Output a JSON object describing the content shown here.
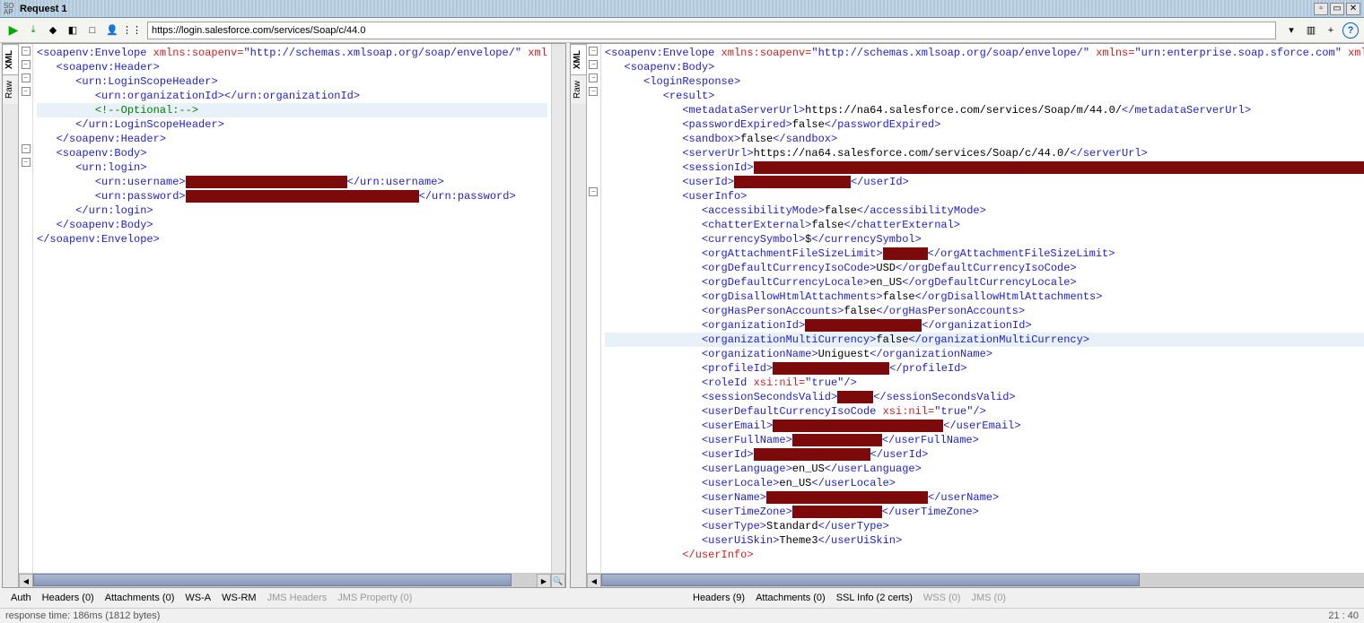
{
  "title": "Request 1",
  "soap_icon": "SO\nAP",
  "url": "https://login.salesforce.com/services/Soap/c/44.0",
  "side_tabs": [
    "XML",
    "Raw"
  ],
  "request_xml": {
    "lines": [
      {
        "p": "<soapenv:Envelope ",
        "a": "xmlns:soapenv=",
        "s": "\"http://schemas.xmlsoap.org/soap/envelope/\"",
        "t": " xml"
      },
      {
        "i": 1,
        "p": "<soapenv:Header>"
      },
      {
        "i": 2,
        "p": "<urn:LoginScopeHeader>"
      },
      {
        "i": 3,
        "p": "<urn:organizationId></urn:organizationId>"
      },
      {
        "i": 3,
        "c": "<!--Optional:-->",
        "hl": true
      },
      {
        "i": 2,
        "p": "</urn:LoginScopeHeader>"
      },
      {
        "i": 1,
        "p": "</soapenv:Header>"
      },
      {
        "i": 1,
        "p": "<soapenv:Body>"
      },
      {
        "i": 2,
        "p": "<urn:login>"
      },
      {
        "i": 3,
        "p": "<urn:username>",
        "r": 180,
        "q": "</urn:username>"
      },
      {
        "i": 3,
        "p": "<urn:password>",
        "r": 260,
        "q": "</urn:password>"
      },
      {
        "i": 2,
        "p": "</urn:login>"
      },
      {
        "i": 1,
        "p": "</soapenv:Body>"
      },
      {
        "p": "</soapenv:Envelope>"
      }
    ]
  },
  "response_xml": {
    "lines": [
      {
        "p": "<soapenv:Envelope ",
        "a": "xmlns:soapenv=",
        "s": "\"http://schemas.xmlsoap.org/soap/envelope/\"",
        "a2": " xmlns=",
        "s2": "\"urn:enterprise.soap.sforce.com\"",
        "t": " xmln"
      },
      {
        "i": 1,
        "p": "<soapenv:Body>"
      },
      {
        "i": 2,
        "p": "<loginResponse>"
      },
      {
        "i": 3,
        "p": "<result>"
      },
      {
        "i": 4,
        "p": "<metadataServerUrl>",
        "v": "https://na64.salesforce.com/services/Soap/m/44.0/",
        "q": "</metadataServerUrl>"
      },
      {
        "i": 4,
        "p": "<passwordExpired>",
        "v": "false",
        "q": "</passwordExpired>"
      },
      {
        "i": 4,
        "p": "<sandbox>",
        "v": "false",
        "q": "</sandbox>"
      },
      {
        "i": 4,
        "p": "<serverUrl>",
        "v": "https://na64.salesforce.com/services/Soap/c/44.0/",
        "q": "</serverUrl>"
      },
      {
        "i": 4,
        "p": "<sessionId>",
        "r": 700,
        "q": ""
      },
      {
        "i": 4,
        "p": "<userId>",
        "r": 130,
        "q": "</userId>"
      },
      {
        "i": 4,
        "p": "<userInfo>"
      },
      {
        "i": 5,
        "p": "<accessibilityMode>",
        "v": "false",
        "q": "</accessibilityMode>"
      },
      {
        "i": 5,
        "p": "<chatterExternal>",
        "v": "false",
        "q": "</chatterExternal>"
      },
      {
        "i": 5,
        "p": "<currencySymbol>",
        "v": "$",
        "q": "</currencySymbol>"
      },
      {
        "i": 5,
        "p": "<orgAttachmentFileSizeLimit>",
        "r": 50,
        "q": "</orgAttachmentFileSizeLimit>"
      },
      {
        "i": 5,
        "p": "<orgDefaultCurrencyIsoCode>",
        "v": "USD",
        "q": "</orgDefaultCurrencyIsoCode>"
      },
      {
        "i": 5,
        "p": "<orgDefaultCurrencyLocale>",
        "v": "en_US",
        "q": "</orgDefaultCurrencyLocale>"
      },
      {
        "i": 5,
        "p": "<orgDisallowHtmlAttachments>",
        "v": "false",
        "q": "</orgDisallowHtmlAttachments>"
      },
      {
        "i": 5,
        "p": "<orgHasPersonAccounts>",
        "v": "false",
        "q": "</orgHasPersonAccounts>"
      },
      {
        "i": 5,
        "p": "<organizationId>",
        "r": 130,
        "q": "</organizationId>"
      },
      {
        "i": 5,
        "p": "<organizationMultiCurrency>",
        "v": "false",
        "q": "</organizationMultiCurrency>",
        "hl": true
      },
      {
        "i": 5,
        "p": "<organizationName>",
        "v": "Uniguest",
        "q": "</organizationName>"
      },
      {
        "i": 5,
        "p": "<profileId>",
        "r": 130,
        "q": "</profileId>"
      },
      {
        "i": 5,
        "p": "<roleId ",
        "a": "xsi:nil=",
        "s": "\"true\"",
        "q": "/>"
      },
      {
        "i": 5,
        "p": "<sessionSecondsValid>",
        "r": 40,
        "q": "</sessionSecondsValid>"
      },
      {
        "i": 5,
        "p": "<userDefaultCurrencyIsoCode ",
        "a": "xsi:nil=",
        "s": "\"true\"",
        "q": "/>"
      },
      {
        "i": 5,
        "p": "<userEmail>",
        "r": 190,
        "q": "</userEmail>"
      },
      {
        "i": 5,
        "p": "<userFullName>",
        "r": 100,
        "q": "</userFullName>"
      },
      {
        "i": 5,
        "p": "<userId>",
        "r": 130,
        "q": "</userId>"
      },
      {
        "i": 5,
        "p": "<userLanguage>",
        "v": "en_US",
        "q": "</userLanguage>"
      },
      {
        "i": 5,
        "p": "<userLocale>",
        "v": "en_US",
        "q": "</userLocale>"
      },
      {
        "i": 5,
        "p": "<userName>",
        "r": 180,
        "q": "</userName>"
      },
      {
        "i": 5,
        "p": "<userTimeZone>",
        "r": 100,
        "q": "</userTimeZone>"
      },
      {
        "i": 5,
        "p": "<userType>",
        "v": "Standard",
        "q": "</userType>"
      },
      {
        "i": 5,
        "p": "<userUiSkin>",
        "v": "Theme3",
        "q": "</userUiSkin>"
      },
      {
        "i": 4,
        "pr": "</userInfo>"
      }
    ]
  },
  "left_tabs": [
    {
      "l": "Auth"
    },
    {
      "l": "Headers (0)"
    },
    {
      "l": "Attachments (0)"
    },
    {
      "l": "WS-A"
    },
    {
      "l": "WS-RM"
    },
    {
      "l": "JMS Headers",
      "d": true
    },
    {
      "l": "JMS Property (0)",
      "d": true
    }
  ],
  "right_tabs": [
    {
      "l": "Headers (9)"
    },
    {
      "l": "Attachments (0)"
    },
    {
      "l": "SSL Info (2 certs)"
    },
    {
      "l": "WSS (0)",
      "d": true
    },
    {
      "l": "JMS (0)",
      "d": true
    }
  ],
  "status_left": "response time: 186ms (1812 bytes)",
  "status_right": "21 : 40"
}
